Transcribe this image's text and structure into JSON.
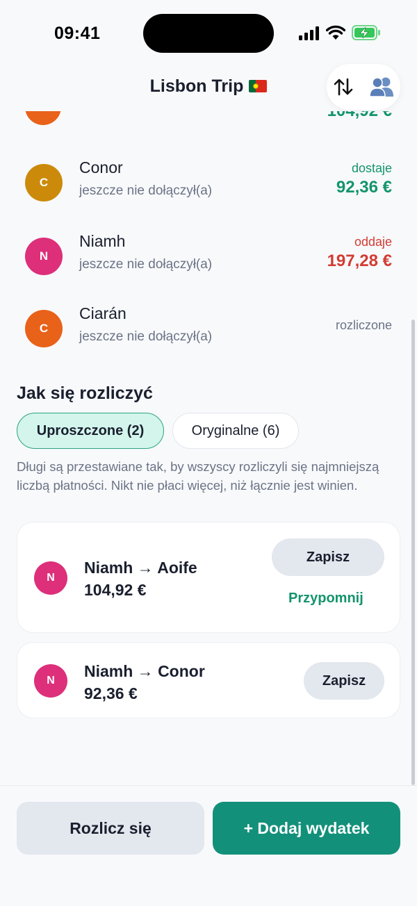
{
  "status_bar": {
    "time": "09:41"
  },
  "header": {
    "title": "Lisbon Trip"
  },
  "partial_row": {
    "amount": "104,92 €"
  },
  "members": [
    {
      "initial": "C",
      "name": "Conor",
      "status": "jeszcze nie dołączył(a)",
      "balance_label": "dostaje",
      "balance_amount": "92,36 €",
      "tone": "green",
      "avatar_color": "#cc8a0a"
    },
    {
      "initial": "N",
      "name": "Niamh",
      "status": "jeszcze nie dołączył(a)",
      "balance_label": "oddaje",
      "balance_amount": "197,28 €",
      "tone": "red",
      "avatar_color": "#dd2f7a"
    },
    {
      "initial": "C",
      "name": "Ciarán",
      "status": "jeszcze nie dołączył(a)",
      "balance_label": "rozliczone",
      "balance_amount": "",
      "tone": "muted",
      "avatar_color": "#e8621a"
    }
  ],
  "settle": {
    "title": "Jak się rozliczyć",
    "tabs": [
      {
        "label": "Uproszczone (2)",
        "active": true
      },
      {
        "label": "Oryginalne (6)",
        "active": false
      }
    ],
    "description": "Długi są przestawiane tak, by wszyscy rozliczyli się najmniejszą liczbą płatności. Nikt nie płaci więcej, niż łącznie jest winien.",
    "payments": [
      {
        "initial": "N",
        "title": "Niamh → Aoife",
        "amount": "104,92 €",
        "save_label": "Zapisz",
        "remind_label": "Przypomnij"
      },
      {
        "initial": "N",
        "title": "Niamh → Conor",
        "amount": "92,36 €",
        "save_label": "Zapisz"
      }
    ]
  },
  "bottom": {
    "settle_label": "Rozlicz się",
    "add_label": "+ Dodaj wydatek"
  },
  "colors": {
    "accent": "#13907a",
    "green": "#14946c",
    "red": "#d23c33"
  }
}
